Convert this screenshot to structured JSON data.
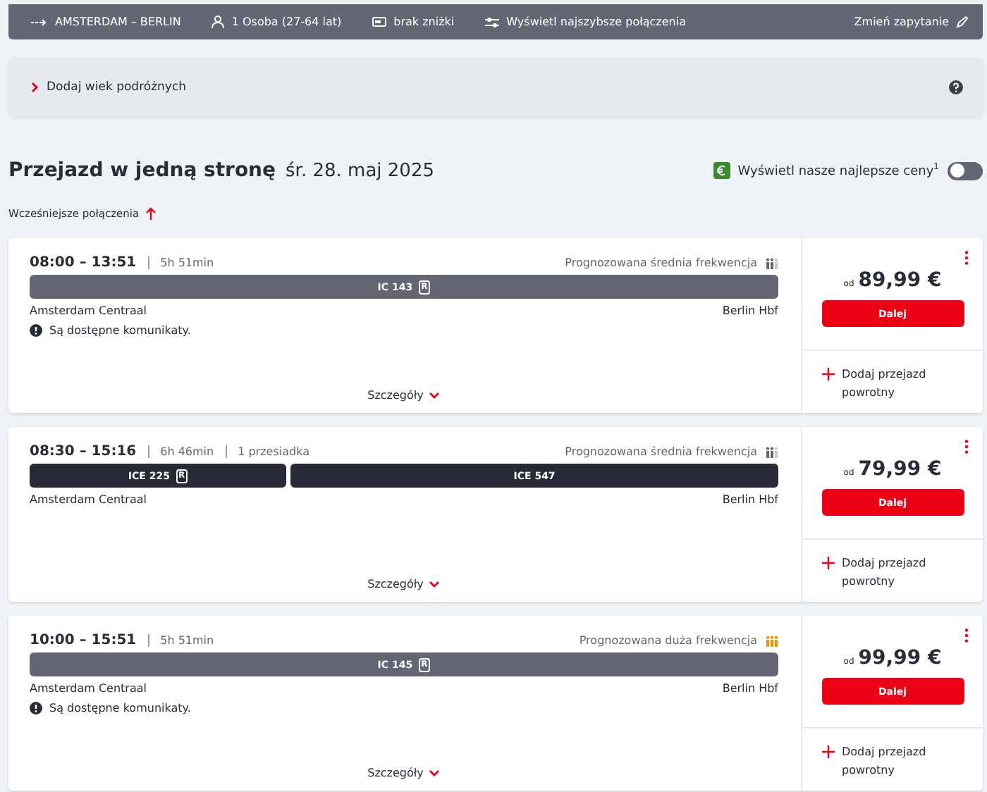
{
  "search_bar": {
    "route": "AMSTERDAM – BERLIN",
    "passengers": "1 Osoba (27-64 lat)",
    "discount": "brak zniżki",
    "fastest": "Wyświetl najszybsze połączenia",
    "change": "Zmień zapytanie"
  },
  "age_panel": {
    "label": "Dodaj wiek podróżnych"
  },
  "heading": {
    "title": "Przejazd w jedną stronę",
    "date": "śr. 28. maj 2025"
  },
  "best_prices": {
    "label": "Wyświetl nasze najlepsze ceny$^{1}$",
    "on": false
  },
  "earlier": "Wcześniejsze połączenia",
  "connections": [
    {
      "times": "08:00 – 13:51",
      "duration": "5h 51min",
      "occupancy": {
        "text": "Prognozowana średnia frekwencja",
        "kind": "medium"
      },
      "segments": [
        {
          "label": "IC 143",
          "badge": "R",
          "color": "#646673"
        }
      ],
      "from": "Amsterdam Centraal",
      "to": "Berlin Hbf",
      "notice": "Są dostępne komunikaty.",
      "details": "Szczegóły",
      "price_prefix": "od",
      "price": "89,99 €",
      "button": "Dalej",
      "return": "Dodaj przejazd powrotny"
    },
    {
      "times": "08:30 – 15:16",
      "duration": "6h 46min",
      "changes": "1 przesiadka",
      "occupancy": {
        "text": "Prognozowana średnia frekwencja",
        "kind": "medium"
      },
      "segments": [
        {
          "label": "ICE 225",
          "badge": "R",
          "color": "#282a37"
        },
        {
          "label": "ICE 547",
          "color": "#282a37"
        }
      ],
      "from": "Amsterdam Centraal",
      "to": "Berlin Hbf",
      "details": "Szczegóły",
      "price_prefix": "od",
      "price": "79,99 €",
      "button": "Dalej",
      "return": "Dodaj przejazd powrotny"
    },
    {
      "times": "10:00 – 15:51",
      "duration": "5h 51min",
      "occupancy": {
        "text": "Prognozowana duża frekwencja",
        "kind": "high"
      },
      "segments": [
        {
          "label": "IC 145",
          "badge": "R",
          "color": "#646673"
        }
      ],
      "from": "Amsterdam Centraal",
      "to": "Berlin Hbf",
      "notice": "Są dostępne komunikaty.",
      "details": "Szczegóły",
      "price_prefix": "od",
      "price": "99,99 €",
      "button": "Dalej",
      "return": "Dodaj przejazd powrotny"
    }
  ]
}
